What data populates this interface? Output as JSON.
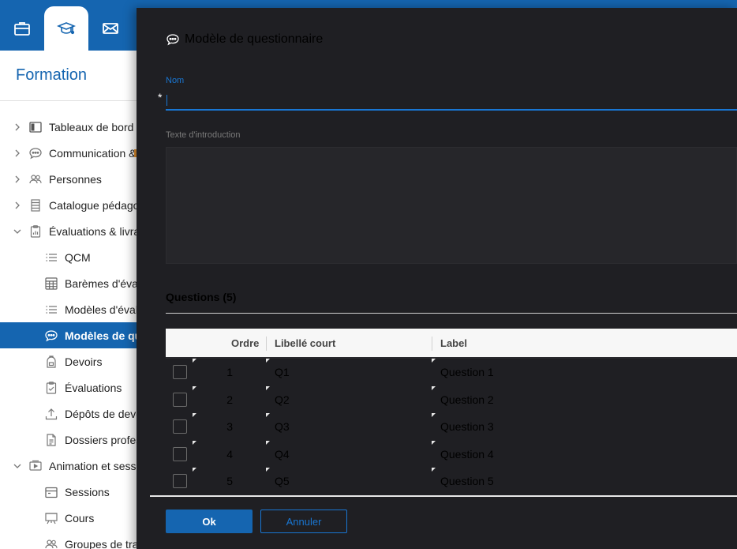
{
  "topbar": {
    "tabs": [
      {
        "icon": "briefcase-icon",
        "active": false
      },
      {
        "icon": "graduation-cap-icon",
        "active": true
      },
      {
        "icon": "envelope-icon",
        "active": false
      }
    ],
    "color": "#1565b0"
  },
  "sidebar": {
    "module_title": "Formation",
    "items": [
      {
        "label": "Tableaux de bord",
        "icon": "dashboard-icon",
        "expandable": true,
        "expanded": false,
        "level": 1
      },
      {
        "label": "Communication & ",
        "icon": "chat-bubble-icon",
        "expandable": true,
        "expanded": false,
        "level": 1
      },
      {
        "label": "Personnes",
        "icon": "people-icon",
        "expandable": true,
        "expanded": false,
        "level": 1
      },
      {
        "label": "Catalogue pédago",
        "icon": "catalog-icon",
        "expandable": true,
        "expanded": false,
        "level": 1
      },
      {
        "label": "Évaluations & livra",
        "icon": "clipboard-chart-icon",
        "expandable": true,
        "expanded": true,
        "level": 1
      },
      {
        "label": "QCM",
        "icon": "list-icon",
        "level": 2
      },
      {
        "label": "Barèmes d'éval",
        "icon": "calculator-icon",
        "level": 2
      },
      {
        "label": "Modèles d'éval",
        "icon": "list-icon",
        "level": 2
      },
      {
        "label": "Modèles de que",
        "icon": "chat-bubble-icon",
        "level": 2,
        "selected": true
      },
      {
        "label": "Devoirs",
        "icon": "backpack-icon",
        "level": 2
      },
      {
        "label": "Évaluations",
        "icon": "clipboard-check-icon",
        "level": 2
      },
      {
        "label": "Dépôts de devo",
        "icon": "upload-icon",
        "level": 2
      },
      {
        "label": "Dossiers profes",
        "icon": "document-icon",
        "level": 2
      },
      {
        "label": "Animation et sessi",
        "icon": "presentation-icon",
        "expandable": true,
        "expanded": true,
        "level": 1
      },
      {
        "label": "Sessions",
        "icon": "calendar-icon",
        "level": 2
      },
      {
        "label": "Cours",
        "icon": "easel-icon",
        "level": 2
      },
      {
        "label": "Groupes de tra",
        "icon": "people-icon",
        "level": 2
      }
    ]
  },
  "modal": {
    "title": "Modèle de questionnaire",
    "title_icon": "chat-bubble-icon",
    "nom_label": "Nom",
    "required_marker": "*",
    "nom_value": "",
    "intro_label": "Texte d'introduction",
    "intro_value": "",
    "questions_title": "Questions (5)",
    "grid": {
      "headers": {
        "order": "Ordre",
        "short_label": "Libellé court",
        "label": "Label"
      },
      "rows": [
        {
          "order": "1",
          "short_label": "Q1",
          "label": "Question 1"
        },
        {
          "order": "2",
          "short_label": "Q2",
          "label": "Question 2"
        },
        {
          "order": "3",
          "short_label": "Q3",
          "label": "Question 3"
        },
        {
          "order": "4",
          "short_label": "Q4",
          "label": "Question 4"
        },
        {
          "order": "5",
          "short_label": "Q5",
          "label": "Question 5"
        }
      ]
    },
    "ok_label": "Ok",
    "cancel_label": "Annuler"
  },
  "colors": {
    "brand": "#1565b0",
    "accent": "#1976d2",
    "modal_bg": "#1f1f23"
  }
}
